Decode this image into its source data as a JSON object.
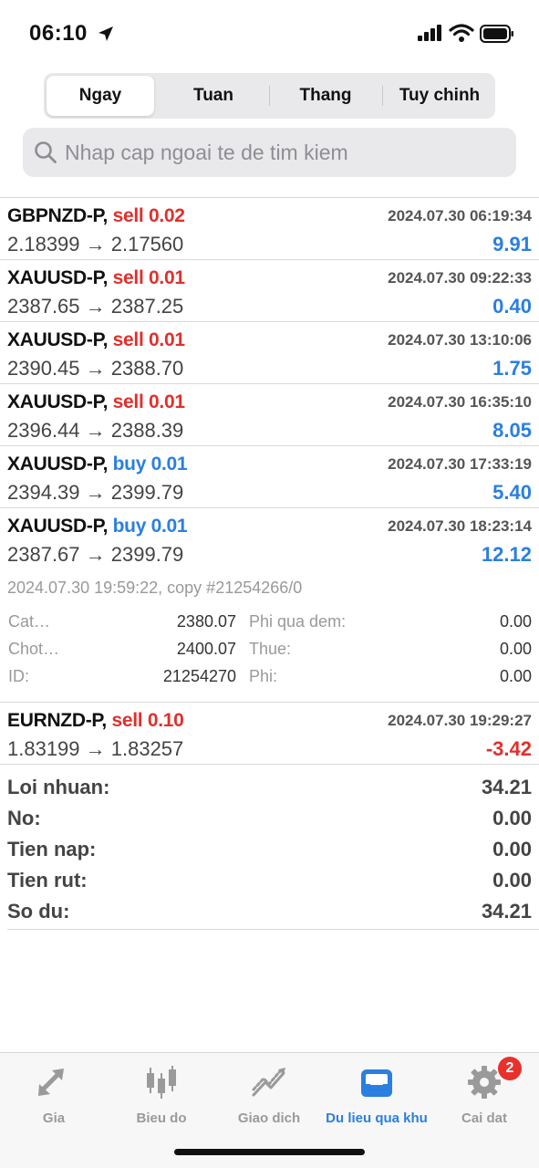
{
  "status": {
    "time": "06:10"
  },
  "segments": [
    "Ngay",
    "Tuan",
    "Thang",
    "Tuy chinh"
  ],
  "search": {
    "placeholder": "Nhap cap ngoai te de tim kiem"
  },
  "trades": [
    {
      "symbol": "GBPNZD-P,",
      "side": "sell",
      "volume": "0.02",
      "time": "2024.07.30 06:19:34",
      "prices": "2.18399 → 2.17560",
      "profit": "9.91"
    },
    {
      "symbol": "XAUUSD-P,",
      "side": "sell",
      "volume": "0.01",
      "time": "2024.07.30 09:22:33",
      "prices": "2387.65 → 2387.25",
      "profit": "0.40"
    },
    {
      "symbol": "XAUUSD-P,",
      "side": "sell",
      "volume": "0.01",
      "time": "2024.07.30 13:10:06",
      "prices": "2390.45 → 2388.70",
      "profit": "1.75"
    },
    {
      "symbol": "XAUUSD-P,",
      "side": "sell",
      "volume": "0.01",
      "time": "2024.07.30 16:35:10",
      "prices": "2396.44 → 2388.39",
      "profit": "8.05"
    },
    {
      "symbol": "XAUUSD-P,",
      "side": "buy",
      "volume": "0.01",
      "time": "2024.07.30 17:33:19",
      "prices": "2394.39 → 2399.79",
      "profit": "5.40"
    },
    {
      "symbol": "XAUUSD-P,",
      "side": "buy",
      "volume": "0.01",
      "time": "2024.07.30 18:23:14",
      "prices": "2387.67 → 2399.79",
      "profit": "12.12"
    }
  ],
  "detail": {
    "line": "2024.07.30 19:59:22, copy #21254266/0",
    "sl_label": "Cat…",
    "sl_value": "2380.07",
    "tp_label": "Chot…",
    "tp_value": "2400.07",
    "id_label": "ID:",
    "id_value": "21254270",
    "swap_label": "Phi qua dem:",
    "swap_value": "0.00",
    "tax_label": "Thue:",
    "tax_value": "0.00",
    "fee_label": "Phi:",
    "fee_value": "0.00"
  },
  "last_trade": {
    "symbol": "EURNZD-P,",
    "side": "sell",
    "volume": "0.10",
    "time": "2024.07.30 19:29:27",
    "prices": "1.83199 → 1.83257",
    "profit": "-3.42"
  },
  "summary": [
    {
      "label": "Loi nhuan:",
      "value": "34.21"
    },
    {
      "label": "No:",
      "value": "0.00"
    },
    {
      "label": "Tien nap:",
      "value": "0.00"
    },
    {
      "label": "Tien rut:",
      "value": "0.00"
    },
    {
      "label": "So du:",
      "value": "34.21"
    }
  ],
  "tabs": [
    {
      "label": "Gia",
      "icon": "arrows-icon"
    },
    {
      "label": "Bieu do",
      "icon": "candlestick-icon"
    },
    {
      "label": "Giao dich",
      "icon": "trend-icon"
    },
    {
      "label": "Du lieu qua khu",
      "icon": "inbox-icon"
    },
    {
      "label": "Cai dat",
      "icon": "gear-icon",
      "badge": "2"
    }
  ],
  "colors": {
    "accent": "#2a7fe0",
    "sell": "#e0302c",
    "badge": "#e8312c"
  }
}
